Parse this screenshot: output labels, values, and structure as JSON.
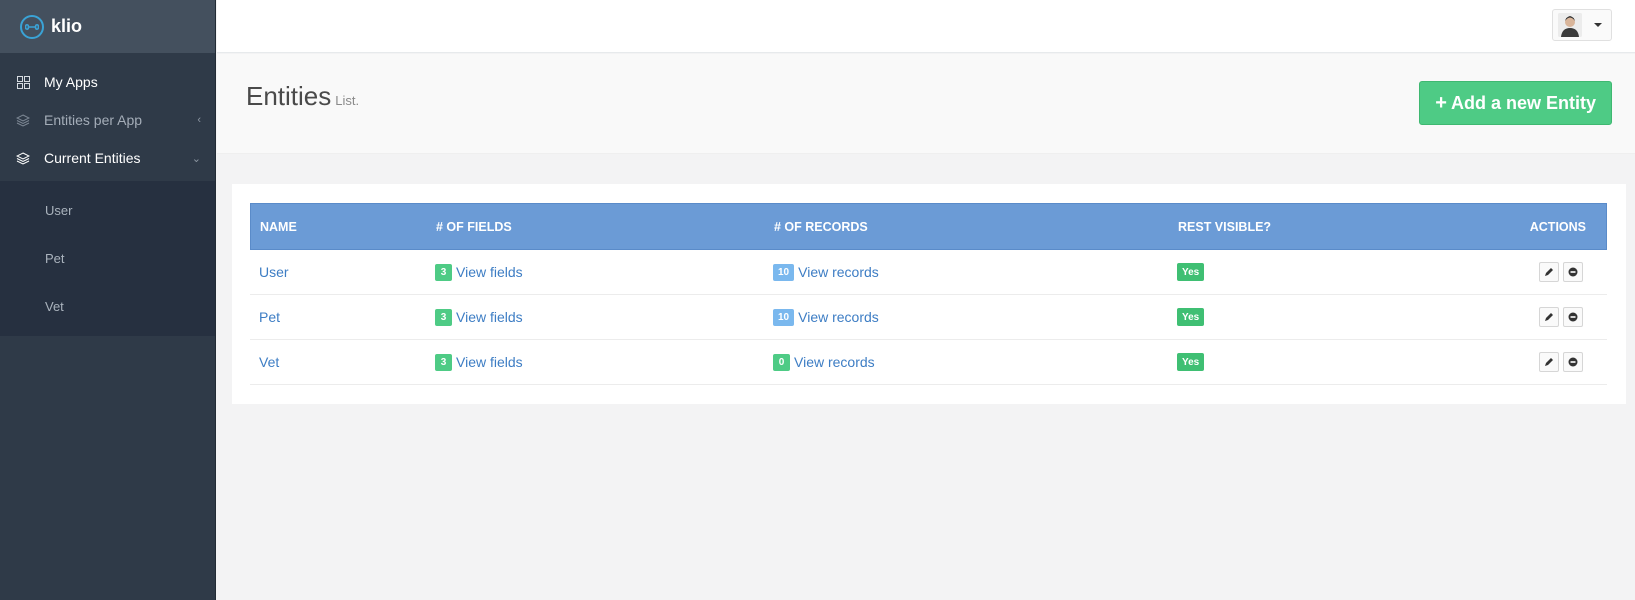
{
  "app": {
    "name": "klio"
  },
  "sidebar": {
    "items": [
      {
        "label": "My Apps",
        "icon": "grid-icon"
      },
      {
        "label": "Entities per App",
        "icon": "layers-icon",
        "caret": "‹"
      },
      {
        "label": "Current Entities",
        "icon": "layers-icon",
        "caret": "⌄"
      }
    ],
    "subitems": [
      {
        "label": "User"
      },
      {
        "label": "Pet"
      },
      {
        "label": "Vet"
      }
    ]
  },
  "header": {
    "user_menu": "avatar"
  },
  "page": {
    "title": "Entities",
    "subtitle": "List.",
    "add_button_label": "Add a new Entity",
    "add_button_icon": "+"
  },
  "table": {
    "columns": [
      "NAME",
      "# OF FIELDS",
      "# OF RECORDS",
      "REST VISIBLE?",
      "ACTIONS"
    ],
    "rows": [
      {
        "name": "User",
        "fields_count": "3",
        "fields_link": "View fields",
        "records_count": "10",
        "records_link": "View records",
        "rest_visible": "Yes"
      },
      {
        "name": "Pet",
        "fields_count": "3",
        "fields_link": "View fields",
        "records_count": "10",
        "records_link": "View records",
        "rest_visible": "Yes"
      },
      {
        "name": "Vet",
        "fields_count": "3",
        "fields_link": "View fields",
        "records_count": "0",
        "records_link": "View records",
        "rest_visible": "Yes"
      }
    ]
  },
  "colors": {
    "sidebar_bg": "#2f3a48",
    "header_row": "#6b9bd6",
    "success": "#4ecb85",
    "info": "#7ab8ee",
    "link": "#3d7dc4"
  }
}
